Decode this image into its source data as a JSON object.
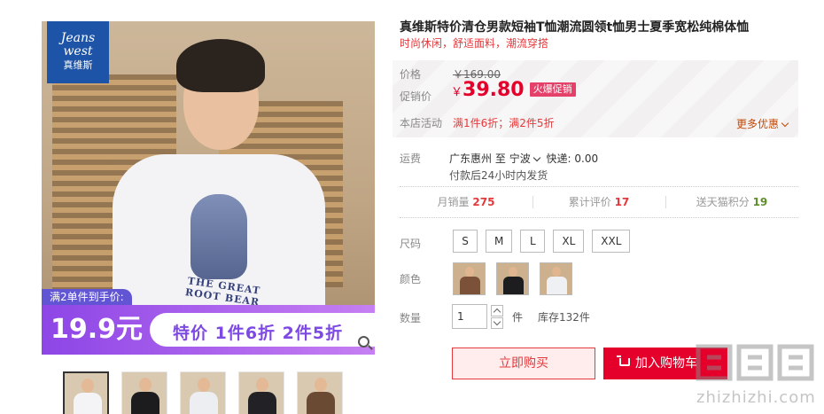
{
  "gallery": {
    "brand_logo": {
      "line1": "Jeans",
      "line2": "west",
      "line3": "真维斯"
    },
    "promo": {
      "tag": "满2单件到手价:",
      "price": "19.9元",
      "deal": "特价 1件6折 2件5折"
    },
    "model_print_text": "THE GREAT ROOT BEAR",
    "thumbnails": [
      {
        "name": "thumb-white-front",
        "shirt_color": "#f4f4f6",
        "active": true
      },
      {
        "name": "thumb-black",
        "shirt_color": "#1c1c1e",
        "active": false
      },
      {
        "name": "thumb-white-side",
        "shirt_color": "#eceef2",
        "active": false
      },
      {
        "name": "thumb-black-2",
        "shirt_color": "#222226",
        "active": false
      },
      {
        "name": "thumb-brown",
        "shirt_color": "#6b4a34",
        "active": false
      }
    ]
  },
  "product": {
    "title": "真维斯特价清仓男款短袖T恤潮流圆领t恤男士夏季宽松纯棉体恤",
    "subtitle": "时尚休闲，舒适面料，潮流穿搭"
  },
  "price_panel": {
    "price_label": "价格",
    "original_price": "￥169.00",
    "promo_label": "促销价",
    "promo_currency": "￥",
    "promo_price": "39.80",
    "hot_badge": "火爆促销",
    "event_label": "本店活动",
    "event_text": "满1件6折；满2件5折",
    "more_link": "更多优惠"
  },
  "shipping": {
    "label": "运费",
    "origin": "广东惠州",
    "to": "至",
    "destination": "宁波",
    "express": "快递: 0.00",
    "note": "付款后24小时内发货"
  },
  "stats": {
    "monthly_sales_label": "月销量",
    "monthly_sales": "275",
    "reviews_label": "累计评价",
    "reviews": "17",
    "points_label": "送天猫积分",
    "points": "19"
  },
  "options": {
    "size_label": "尺码",
    "sizes": [
      "S",
      "M",
      "L",
      "XL",
      "XXL"
    ],
    "color_label": "颜色",
    "colors": [
      {
        "name": "brown",
        "shirt": "#7b5239"
      },
      {
        "name": "black",
        "shirt": "#1d1d20"
      },
      {
        "name": "white",
        "shirt": "#eef0f4"
      }
    ],
    "qty_label": "数量",
    "qty_value": "1",
    "unit": "件",
    "stock": "库存132件"
  },
  "actions": {
    "buy_now": "立即购买",
    "add_cart": "加入购物车"
  },
  "watermark": {
    "text": "zhizhizhi.com",
    "icon": "zhi-logo-icon"
  },
  "colors": {
    "accent_red": "#e4002b",
    "promo_purple": "#8d45e6",
    "brand_blue": "#1e54a7"
  }
}
